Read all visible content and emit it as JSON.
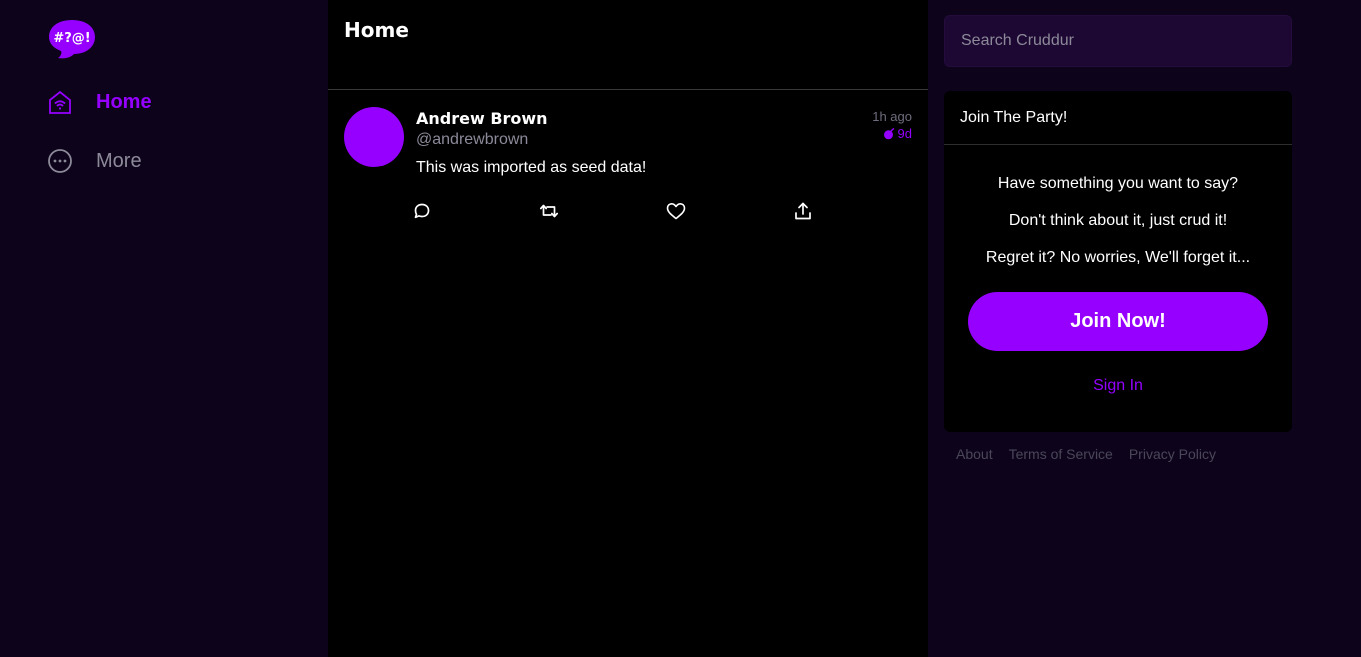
{
  "nav": {
    "logo_text": "#?@!",
    "items": [
      {
        "label": "Home",
        "icon": "home-icon",
        "active": true
      },
      {
        "label": "More",
        "icon": "more-icon",
        "active": false
      }
    ]
  },
  "feed": {
    "title": "Home",
    "posts": [
      {
        "display_name": "Andrew Brown",
        "handle": "@andrewbrown",
        "time_ago": "1h ago",
        "expires_in": "9d",
        "message": "This was imported as seed data!",
        "actions": [
          "reply-icon",
          "repost-icon",
          "like-icon",
          "share-icon"
        ]
      }
    ]
  },
  "sidebar": {
    "search": {
      "placeholder": "Search Cruddur",
      "value": ""
    },
    "join": {
      "title": "Join The Party!",
      "lines": [
        "Have something you want to say?",
        "Don't think about it, just crud it!",
        "Regret it? No worries, We'll forget it..."
      ],
      "button_label": "Join Now!",
      "signin_label": "Sign In"
    },
    "footer": [
      "About",
      "Terms of Service",
      "Privacy Policy"
    ]
  },
  "colors": {
    "accent": "#9500ff",
    "background": "#0d041c",
    "feed_background": "#000000",
    "search_background": "#1d0733",
    "muted_text": "#8c8a99"
  }
}
